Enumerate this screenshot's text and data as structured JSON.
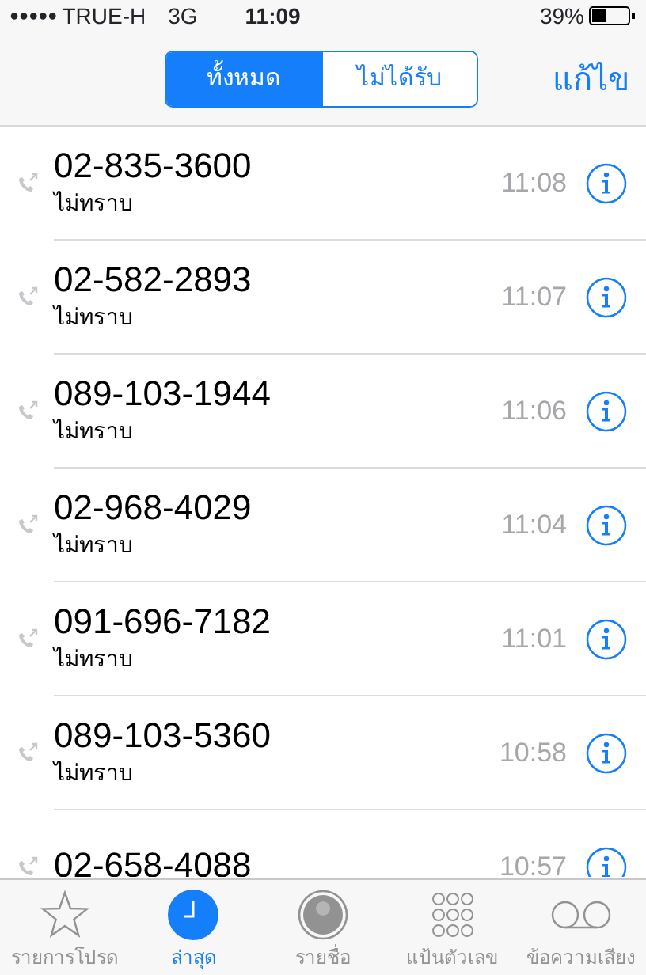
{
  "status_bar": {
    "signal": "●●●●●",
    "carrier": "TRUE-H",
    "network": "3G",
    "time": "11:09",
    "battery": "39%"
  },
  "segments": [
    {
      "label": "ทั้งหมด",
      "selected": true
    },
    {
      "label": "ไม่ได้รับ",
      "selected": false
    }
  ],
  "edit_button": "แก้ไข",
  "calls": [
    {
      "number": "02-835-3600",
      "label": "ไม่ทราบ",
      "time": "11:08"
    },
    {
      "number": "02-582-2893",
      "label": "ไม่ทราบ",
      "time": "11:07"
    },
    {
      "number": "089-103-1944",
      "label": "ไม่ทราบ",
      "time": "11:06"
    },
    {
      "number": "02-968-4029",
      "label": "ไม่ทราบ",
      "time": "11:04"
    },
    {
      "number": "091-696-7182",
      "label": "ไม่ทราบ",
      "time": "11:01"
    },
    {
      "number": "089-103-5360",
      "label": "ไม่ทราบ",
      "time": "10:58"
    },
    {
      "number": "02-658-4088",
      "time": "10:57"
    }
  ],
  "tab_bar": [
    {
      "label": "รายการโปรด",
      "selected": false
    },
    {
      "label": "ล่าสุด",
      "selected": true
    },
    {
      "label": "รายชื่อ",
      "selected": false
    },
    {
      "label": "แป้นตัวเลข",
      "selected": false
    },
    {
      "label": "ข้อความเสียง",
      "selected": false
    }
  ]
}
